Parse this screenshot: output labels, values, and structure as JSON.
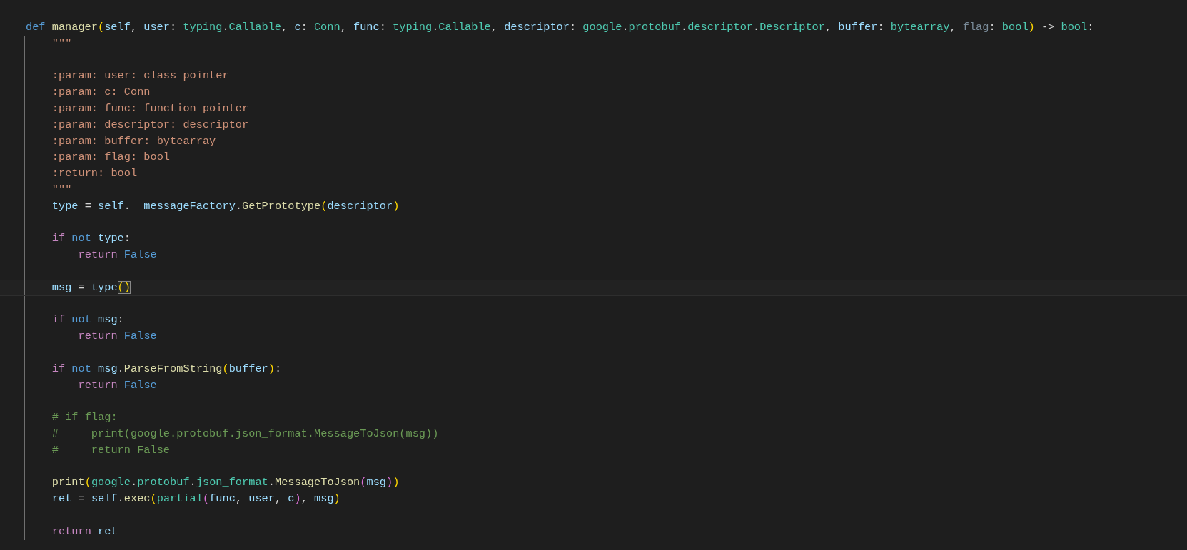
{
  "editor": {
    "lines": [
      {
        "kind": "block",
        "tokens": [
          {
            "text": "def ",
            "kind": "kw"
          },
          {
            "text": "manager",
            "kind": "fn"
          },
          {
            "text": "(",
            "kind": "b1"
          },
          {
            "text": "self",
            "kind": "param"
          },
          {
            "text": ", ",
            "kind": "punc"
          },
          {
            "text": "user",
            "kind": "param"
          },
          {
            "text": ": ",
            "kind": "punc"
          },
          {
            "text": "typing",
            "kind": "type"
          },
          {
            "text": ".",
            "kind": "punc"
          },
          {
            "text": "Callable",
            "kind": "type"
          },
          {
            "text": ", ",
            "kind": "punc"
          },
          {
            "text": "c",
            "kind": "param"
          },
          {
            "text": ": ",
            "kind": "punc"
          },
          {
            "text": "Conn",
            "kind": "type"
          },
          {
            "text": ", ",
            "kind": "punc"
          },
          {
            "text": "func",
            "kind": "param"
          },
          {
            "text": ": ",
            "kind": "punc"
          },
          {
            "text": "typing",
            "kind": "type"
          },
          {
            "text": ".",
            "kind": "punc"
          },
          {
            "text": "Callable",
            "kind": "type"
          },
          {
            "text": ", ",
            "kind": "punc"
          },
          {
            "text": "descriptor",
            "kind": "param"
          },
          {
            "text": ": ",
            "kind": "punc"
          },
          {
            "text": "google",
            "kind": "type"
          },
          {
            "text": ".",
            "kind": "punc"
          },
          {
            "text": "protobuf",
            "kind": "type"
          },
          {
            "text": ".",
            "kind": "punc"
          },
          {
            "text": "descriptor",
            "kind": "type"
          },
          {
            "text": ".",
            "kind": "punc"
          },
          {
            "text": "Descriptor",
            "kind": "type"
          },
          {
            "text": ", ",
            "kind": "punc"
          },
          {
            "text": "buffer",
            "kind": "param"
          },
          {
            "text": ": ",
            "kind": "punc"
          },
          {
            "text": "bytearray",
            "kind": "type"
          },
          {
            "text": ", ",
            "kind": "punc"
          },
          {
            "text": "flag",
            "kind": "unused"
          },
          {
            "text": ": ",
            "kind": "punc"
          },
          {
            "text": "bool",
            "kind": "type"
          },
          {
            "text": ")",
            "kind": "b1"
          },
          {
            "text": " -> ",
            "kind": "punc"
          },
          {
            "text": "bool",
            "kind": "type"
          },
          {
            "text": ":",
            "kind": "punc"
          }
        ],
        "children": [
          {
            "kind": "line",
            "tokens": [
              {
                "text": "\"\"\"",
                "kind": "str"
              }
            ]
          },
          {
            "kind": "blank"
          },
          {
            "kind": "line",
            "tokens": [
              {
                "text": ":param: user: class pointer",
                "kind": "str"
              }
            ]
          },
          {
            "kind": "line",
            "tokens": [
              {
                "text": ":param: c: Conn",
                "kind": "str"
              }
            ]
          },
          {
            "kind": "line",
            "tokens": [
              {
                "text": ":param: func: function pointer",
                "kind": "str"
              }
            ]
          },
          {
            "kind": "line",
            "tokens": [
              {
                "text": ":param: descriptor: descriptor",
                "kind": "str"
              }
            ]
          },
          {
            "kind": "line",
            "tokens": [
              {
                "text": ":param: buffer: bytearray",
                "kind": "str"
              }
            ]
          },
          {
            "kind": "line",
            "tokens": [
              {
                "text": ":param: flag: bool",
                "kind": "str"
              }
            ]
          },
          {
            "kind": "line",
            "tokens": [
              {
                "text": ":return: bool",
                "kind": "str"
              }
            ]
          },
          {
            "kind": "line",
            "tokens": [
              {
                "text": "\"\"\"",
                "kind": "str"
              }
            ]
          },
          {
            "kind": "line",
            "tokens": [
              {
                "text": "type",
                "kind": "var"
              },
              {
                "text": " = ",
                "kind": "punc"
              },
              {
                "text": "self",
                "kind": "var"
              },
              {
                "text": ".",
                "kind": "punc"
              },
              {
                "text": "__messageFactory",
                "kind": "var"
              },
              {
                "text": ".",
                "kind": "punc"
              },
              {
                "text": "GetPrototype",
                "kind": "fn"
              },
              {
                "text": "(",
                "kind": "b1"
              },
              {
                "text": "descriptor",
                "kind": "var"
              },
              {
                "text": ")",
                "kind": "b1"
              }
            ]
          },
          {
            "kind": "blank"
          },
          {
            "kind": "block",
            "tokens": [
              {
                "text": "if ",
                "kind": "ctrl"
              },
              {
                "text": "not ",
                "kind": "kw"
              },
              {
                "text": "type",
                "kind": "var"
              },
              {
                "text": ":",
                "kind": "punc"
              }
            ],
            "children": [
              {
                "kind": "line",
                "tokens": [
                  {
                    "text": "return ",
                    "kind": "ctrl"
                  },
                  {
                    "text": "False",
                    "kind": "kw"
                  }
                ]
              }
            ]
          },
          {
            "kind": "blank"
          },
          {
            "kind": "line",
            "current": true,
            "tokens": [
              {
                "text": "msg",
                "kind": "var"
              },
              {
                "text": " = ",
                "kind": "punc"
              },
              {
                "text": "type",
                "kind": "var"
              },
              {
                "text": "()",
                "kind": "b1",
                "matched": true
              }
            ]
          },
          {
            "kind": "blank"
          },
          {
            "kind": "block",
            "tokens": [
              {
                "text": "if ",
                "kind": "ctrl"
              },
              {
                "text": "not ",
                "kind": "kw"
              },
              {
                "text": "msg",
                "kind": "var"
              },
              {
                "text": ":",
                "kind": "punc"
              }
            ],
            "children": [
              {
                "kind": "line",
                "tokens": [
                  {
                    "text": "return ",
                    "kind": "ctrl"
                  },
                  {
                    "text": "False",
                    "kind": "kw"
                  }
                ]
              }
            ]
          },
          {
            "kind": "blank"
          },
          {
            "kind": "block",
            "tokens": [
              {
                "text": "if ",
                "kind": "ctrl"
              },
              {
                "text": "not ",
                "kind": "kw"
              },
              {
                "text": "msg",
                "kind": "var"
              },
              {
                "text": ".",
                "kind": "punc"
              },
              {
                "text": "ParseFromString",
                "kind": "fn"
              },
              {
                "text": "(",
                "kind": "b1"
              },
              {
                "text": "buffer",
                "kind": "var"
              },
              {
                "text": ")",
                "kind": "b1"
              },
              {
                "text": ":",
                "kind": "punc"
              }
            ],
            "children": [
              {
                "kind": "line",
                "tokens": [
                  {
                    "text": "return ",
                    "kind": "ctrl"
                  },
                  {
                    "text": "False",
                    "kind": "kw"
                  }
                ]
              }
            ]
          },
          {
            "kind": "blank"
          },
          {
            "kind": "line",
            "tokens": [
              {
                "text": "# if flag:",
                "kind": "comment"
              }
            ]
          },
          {
            "kind": "line",
            "tokens": [
              {
                "text": "#     print(google.protobuf.json_format.MessageToJson(msg))",
                "kind": "comment"
              }
            ]
          },
          {
            "kind": "line",
            "tokens": [
              {
                "text": "#     return False",
                "kind": "comment"
              }
            ]
          },
          {
            "kind": "blank"
          },
          {
            "kind": "line",
            "tokens": [
              {
                "text": "print",
                "kind": "fn"
              },
              {
                "text": "(",
                "kind": "b1"
              },
              {
                "text": "google",
                "kind": "type"
              },
              {
                "text": ".",
                "kind": "punc"
              },
              {
                "text": "protobuf",
                "kind": "type"
              },
              {
                "text": ".",
                "kind": "punc"
              },
              {
                "text": "json_format",
                "kind": "type"
              },
              {
                "text": ".",
                "kind": "punc"
              },
              {
                "text": "MessageToJson",
                "kind": "fn"
              },
              {
                "text": "(",
                "kind": "b2"
              },
              {
                "text": "msg",
                "kind": "var"
              },
              {
                "text": ")",
                "kind": "b2"
              },
              {
                "text": ")",
                "kind": "b1"
              }
            ]
          },
          {
            "kind": "line",
            "tokens": [
              {
                "text": "ret",
                "kind": "var"
              },
              {
                "text": " = ",
                "kind": "punc"
              },
              {
                "text": "self",
                "kind": "var"
              },
              {
                "text": ".",
                "kind": "punc"
              },
              {
                "text": "exec",
                "kind": "fn"
              },
              {
                "text": "(",
                "kind": "b1"
              },
              {
                "text": "partial",
                "kind": "type"
              },
              {
                "text": "(",
                "kind": "b2"
              },
              {
                "text": "func",
                "kind": "var"
              },
              {
                "text": ", ",
                "kind": "punc"
              },
              {
                "text": "user",
                "kind": "var"
              },
              {
                "text": ", ",
                "kind": "punc"
              },
              {
                "text": "c",
                "kind": "var"
              },
              {
                "text": ")",
                "kind": "b2"
              },
              {
                "text": ", ",
                "kind": "punc"
              },
              {
                "text": "msg",
                "kind": "var"
              },
              {
                "text": ")",
                "kind": "b1"
              }
            ]
          },
          {
            "kind": "blank"
          },
          {
            "kind": "line",
            "tokens": [
              {
                "text": "return ",
                "kind": "ctrl"
              },
              {
                "text": "ret",
                "kind": "var"
              }
            ]
          }
        ]
      }
    ]
  }
}
